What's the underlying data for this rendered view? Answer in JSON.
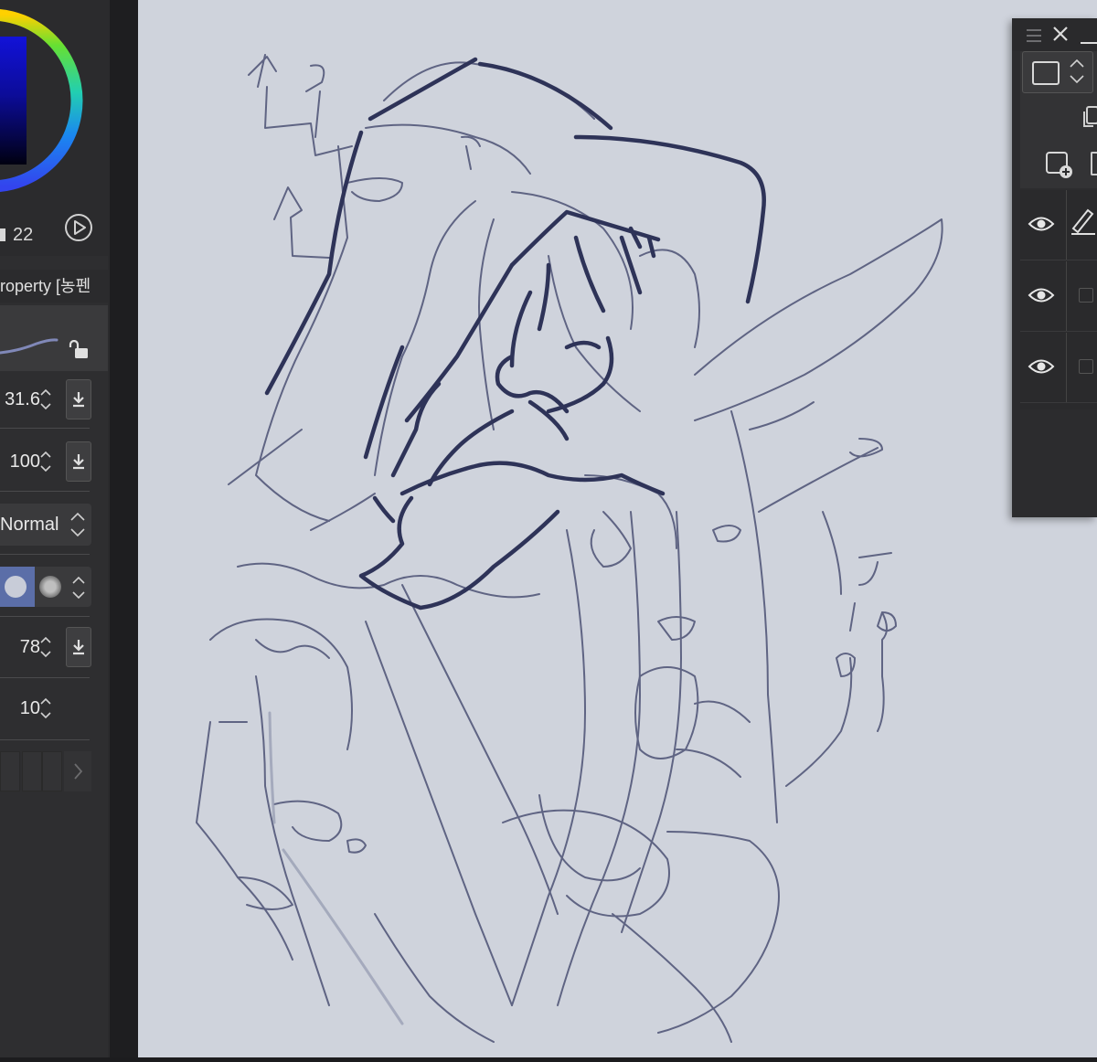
{
  "color_panel": {
    "brush_size": "22",
    "hue_ring_colors": [
      "#ffcc00",
      "#66e033",
      "#22d4b4",
      "#1a88f0",
      "#3344ee"
    ],
    "current_color": "#1212d8"
  },
  "tool_property": {
    "tab_label": "roperty [농펜",
    "brush_size_value": "31.6",
    "opacity_value": "100",
    "blend_mode": "Normal",
    "density_value": "78",
    "stabilization_value": "10"
  },
  "canvas": {
    "background": "#cfd3dc",
    "stroke_color": "#2e3358"
  },
  "layer_panel": {
    "layers": [
      {
        "visible": true,
        "active": true
      },
      {
        "visible": true,
        "active": false
      },
      {
        "visible": true,
        "active": false
      }
    ]
  }
}
